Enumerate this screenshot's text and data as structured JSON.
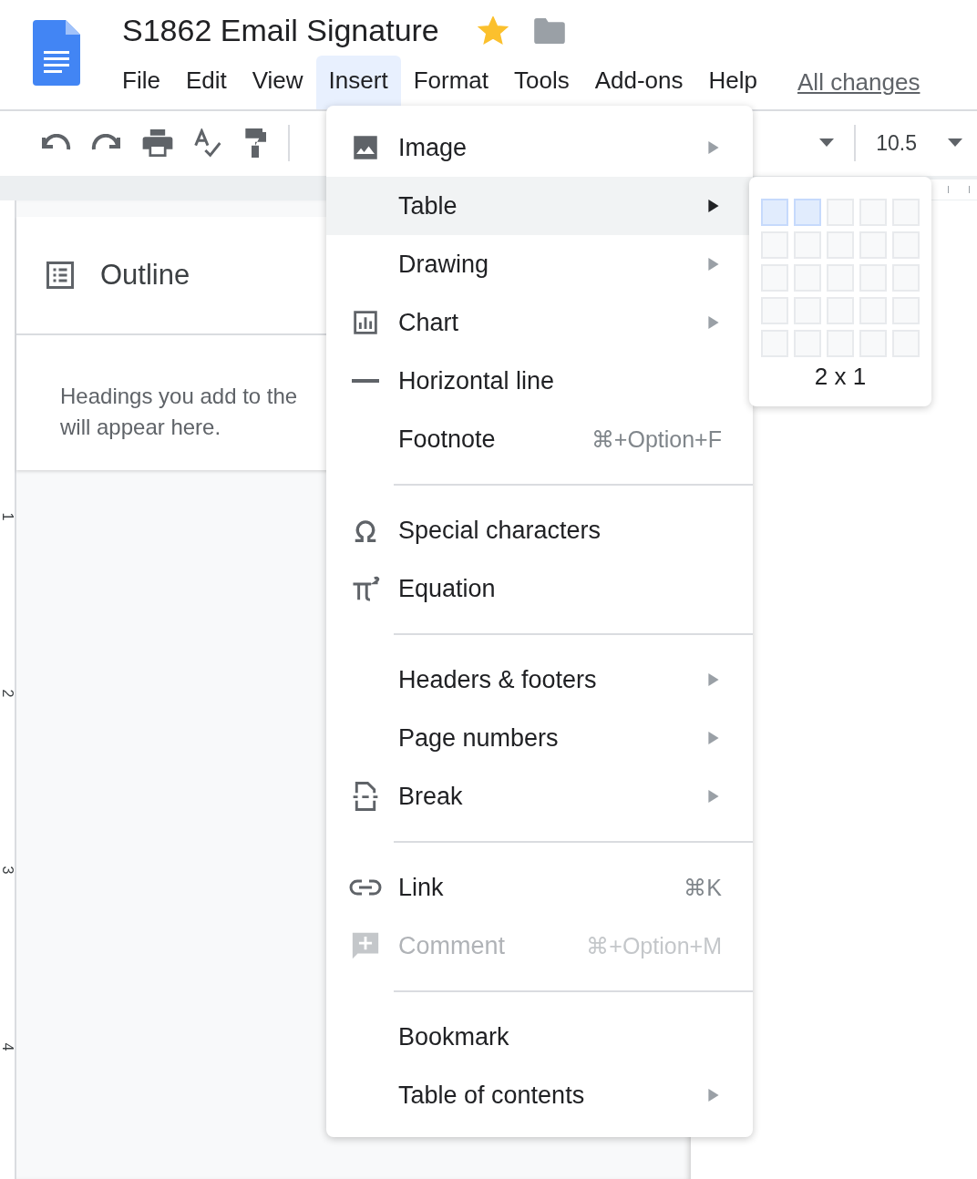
{
  "doc": {
    "title": "S1862 Email Signature",
    "starred": true
  },
  "menubar": [
    {
      "label": "File",
      "selected": false
    },
    {
      "label": "Edit",
      "selected": false
    },
    {
      "label": "View",
      "selected": false
    },
    {
      "label": "Insert",
      "selected": true
    },
    {
      "label": "Format",
      "selected": false
    },
    {
      "label": "Tools",
      "selected": false
    },
    {
      "label": "Add-ons",
      "selected": false
    },
    {
      "label": "Help",
      "selected": false
    }
  ],
  "save_status": "All changes",
  "toolbar": {
    "font_size": "10.5"
  },
  "ruler_numbers": [
    "1",
    "2",
    "3",
    "4"
  ],
  "outline": {
    "title": "Outline",
    "hint_lines": [
      "Headings you add to the",
      "will appear here."
    ]
  },
  "insert_menu": [
    {
      "kind": "item",
      "label": "Image",
      "submenu": true,
      "disabled": false,
      "selected": false
    },
    {
      "kind": "item",
      "label": "Table",
      "submenu": true,
      "disabled": false,
      "selected": true
    },
    {
      "kind": "item",
      "label": "Drawing",
      "submenu": true,
      "disabled": false,
      "selected": false
    },
    {
      "kind": "item",
      "label": "Chart",
      "submenu": true,
      "disabled": false,
      "selected": false
    },
    {
      "kind": "item",
      "label": "Horizontal line",
      "submenu": false,
      "disabled": false,
      "selected": false
    },
    {
      "kind": "item",
      "label": "Footnote",
      "shortcut": "⌘+Option+F",
      "submenu": false,
      "disabled": false,
      "selected": false
    },
    {
      "kind": "separator"
    },
    {
      "kind": "item",
      "label": "Special characters",
      "submenu": false,
      "disabled": false,
      "selected": false
    },
    {
      "kind": "item",
      "label": "Equation",
      "submenu": false,
      "disabled": false,
      "selected": false
    },
    {
      "kind": "separator"
    },
    {
      "kind": "item",
      "label": "Headers & footers",
      "submenu": true,
      "disabled": false,
      "selected": false
    },
    {
      "kind": "item",
      "label": "Page numbers",
      "submenu": true,
      "disabled": false,
      "selected": false
    },
    {
      "kind": "item",
      "label": "Break",
      "submenu": true,
      "disabled": false,
      "selected": false
    },
    {
      "kind": "separator"
    },
    {
      "kind": "item",
      "label": "Link",
      "shortcut": "⌘K",
      "submenu": false,
      "disabled": false,
      "selected": false
    },
    {
      "kind": "item",
      "label": "Comment",
      "shortcut": "⌘+Option+M",
      "submenu": false,
      "disabled": true,
      "selected": false
    },
    {
      "kind": "separator"
    },
    {
      "kind": "item",
      "label": "Bookmark",
      "submenu": false,
      "disabled": false,
      "selected": false
    },
    {
      "kind": "item",
      "label": "Table of contents",
      "submenu": true,
      "disabled": false,
      "selected": false
    }
  ],
  "table_picker": {
    "size_label": "2 x 1",
    "rows": [
      [
        {
          "selected": true
        },
        {
          "selected": true
        },
        {
          "selected": false
        },
        {
          "selected": false
        },
        {
          "selected": false
        }
      ],
      [
        {
          "selected": false
        },
        {
          "selected": false
        },
        {
          "selected": false
        },
        {
          "selected": false
        },
        {
          "selected": false
        }
      ],
      [
        {
          "selected": false
        },
        {
          "selected": false
        },
        {
          "selected": false
        },
        {
          "selected": false
        },
        {
          "selected": false
        }
      ],
      [
        {
          "selected": false
        },
        {
          "selected": false
        },
        {
          "selected": false
        },
        {
          "selected": false
        },
        {
          "selected": false
        }
      ],
      [
        {
          "selected": false
        },
        {
          "selected": false
        },
        {
          "selected": false
        },
        {
          "selected": false
        },
        {
          "selected": false
        }
      ]
    ]
  }
}
